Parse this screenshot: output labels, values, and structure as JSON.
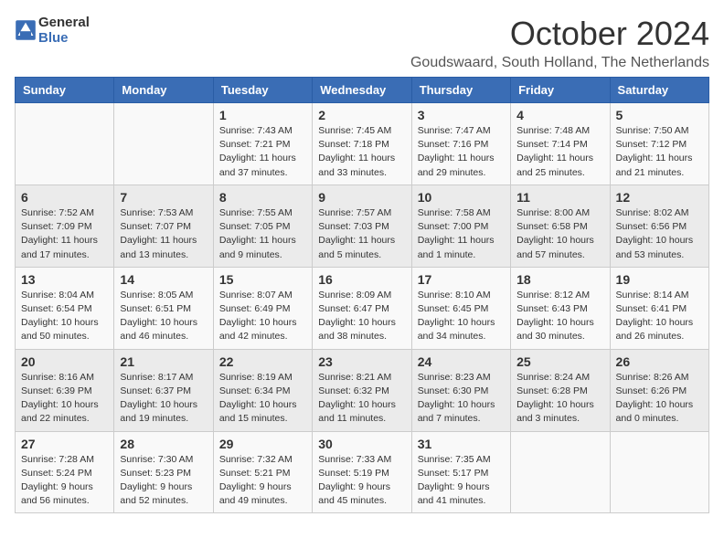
{
  "logo": {
    "line1": "General",
    "line2": "Blue"
  },
  "title": "October 2024",
  "location": "Goudswaard, South Holland, The Netherlands",
  "days_of_week": [
    "Sunday",
    "Monday",
    "Tuesday",
    "Wednesday",
    "Thursday",
    "Friday",
    "Saturday"
  ],
  "weeks": [
    [
      {
        "day": "",
        "info": ""
      },
      {
        "day": "",
        "info": ""
      },
      {
        "day": "1",
        "info": "Sunrise: 7:43 AM\nSunset: 7:21 PM\nDaylight: 11 hours\nand 37 minutes."
      },
      {
        "day": "2",
        "info": "Sunrise: 7:45 AM\nSunset: 7:18 PM\nDaylight: 11 hours\nand 33 minutes."
      },
      {
        "day": "3",
        "info": "Sunrise: 7:47 AM\nSunset: 7:16 PM\nDaylight: 11 hours\nand 29 minutes."
      },
      {
        "day": "4",
        "info": "Sunrise: 7:48 AM\nSunset: 7:14 PM\nDaylight: 11 hours\nand 25 minutes."
      },
      {
        "day": "5",
        "info": "Sunrise: 7:50 AM\nSunset: 7:12 PM\nDaylight: 11 hours\nand 21 minutes."
      }
    ],
    [
      {
        "day": "6",
        "info": "Sunrise: 7:52 AM\nSunset: 7:09 PM\nDaylight: 11 hours\nand 17 minutes."
      },
      {
        "day": "7",
        "info": "Sunrise: 7:53 AM\nSunset: 7:07 PM\nDaylight: 11 hours\nand 13 minutes."
      },
      {
        "day": "8",
        "info": "Sunrise: 7:55 AM\nSunset: 7:05 PM\nDaylight: 11 hours\nand 9 minutes."
      },
      {
        "day": "9",
        "info": "Sunrise: 7:57 AM\nSunset: 7:03 PM\nDaylight: 11 hours\nand 5 minutes."
      },
      {
        "day": "10",
        "info": "Sunrise: 7:58 AM\nSunset: 7:00 PM\nDaylight: 11 hours\nand 1 minute."
      },
      {
        "day": "11",
        "info": "Sunrise: 8:00 AM\nSunset: 6:58 PM\nDaylight: 10 hours\nand 57 minutes."
      },
      {
        "day": "12",
        "info": "Sunrise: 8:02 AM\nSunset: 6:56 PM\nDaylight: 10 hours\nand 53 minutes."
      }
    ],
    [
      {
        "day": "13",
        "info": "Sunrise: 8:04 AM\nSunset: 6:54 PM\nDaylight: 10 hours\nand 50 minutes."
      },
      {
        "day": "14",
        "info": "Sunrise: 8:05 AM\nSunset: 6:51 PM\nDaylight: 10 hours\nand 46 minutes."
      },
      {
        "day": "15",
        "info": "Sunrise: 8:07 AM\nSunset: 6:49 PM\nDaylight: 10 hours\nand 42 minutes."
      },
      {
        "day": "16",
        "info": "Sunrise: 8:09 AM\nSunset: 6:47 PM\nDaylight: 10 hours\nand 38 minutes."
      },
      {
        "day": "17",
        "info": "Sunrise: 8:10 AM\nSunset: 6:45 PM\nDaylight: 10 hours\nand 34 minutes."
      },
      {
        "day": "18",
        "info": "Sunrise: 8:12 AM\nSunset: 6:43 PM\nDaylight: 10 hours\nand 30 minutes."
      },
      {
        "day": "19",
        "info": "Sunrise: 8:14 AM\nSunset: 6:41 PM\nDaylight: 10 hours\nand 26 minutes."
      }
    ],
    [
      {
        "day": "20",
        "info": "Sunrise: 8:16 AM\nSunset: 6:39 PM\nDaylight: 10 hours\nand 22 minutes."
      },
      {
        "day": "21",
        "info": "Sunrise: 8:17 AM\nSunset: 6:37 PM\nDaylight: 10 hours\nand 19 minutes."
      },
      {
        "day": "22",
        "info": "Sunrise: 8:19 AM\nSunset: 6:34 PM\nDaylight: 10 hours\nand 15 minutes."
      },
      {
        "day": "23",
        "info": "Sunrise: 8:21 AM\nSunset: 6:32 PM\nDaylight: 10 hours\nand 11 minutes."
      },
      {
        "day": "24",
        "info": "Sunrise: 8:23 AM\nSunset: 6:30 PM\nDaylight: 10 hours\nand 7 minutes."
      },
      {
        "day": "25",
        "info": "Sunrise: 8:24 AM\nSunset: 6:28 PM\nDaylight: 10 hours\nand 3 minutes."
      },
      {
        "day": "26",
        "info": "Sunrise: 8:26 AM\nSunset: 6:26 PM\nDaylight: 10 hours\nand 0 minutes."
      }
    ],
    [
      {
        "day": "27",
        "info": "Sunrise: 7:28 AM\nSunset: 5:24 PM\nDaylight: 9 hours\nand 56 minutes."
      },
      {
        "day": "28",
        "info": "Sunrise: 7:30 AM\nSunset: 5:23 PM\nDaylight: 9 hours\nand 52 minutes."
      },
      {
        "day": "29",
        "info": "Sunrise: 7:32 AM\nSunset: 5:21 PM\nDaylight: 9 hours\nand 49 minutes."
      },
      {
        "day": "30",
        "info": "Sunrise: 7:33 AM\nSunset: 5:19 PM\nDaylight: 9 hours\nand 45 minutes."
      },
      {
        "day": "31",
        "info": "Sunrise: 7:35 AM\nSunset: 5:17 PM\nDaylight: 9 hours\nand 41 minutes."
      },
      {
        "day": "",
        "info": ""
      },
      {
        "day": "",
        "info": ""
      }
    ]
  ]
}
